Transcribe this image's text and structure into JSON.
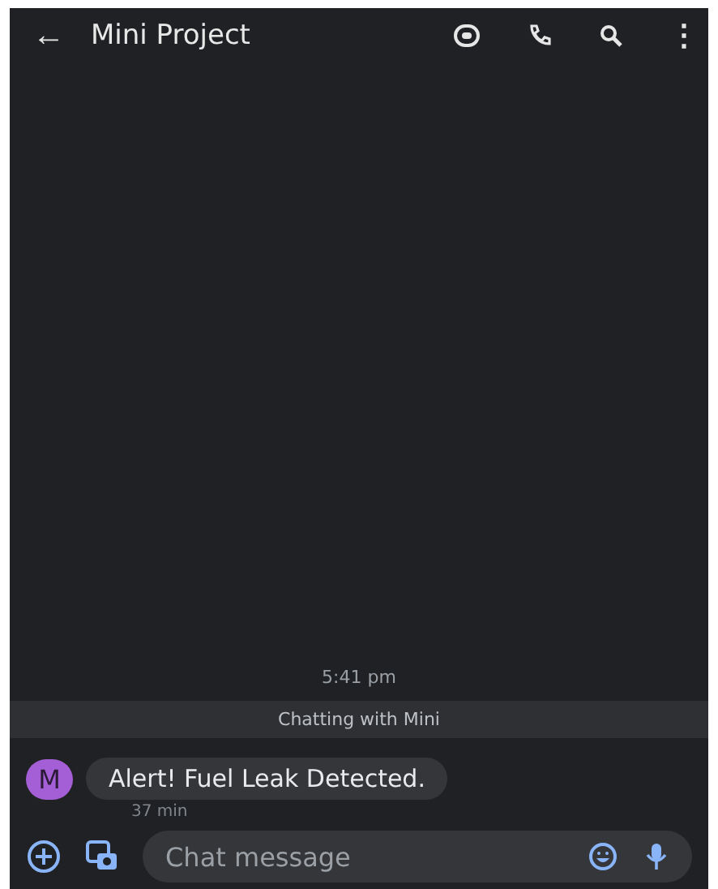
{
  "header": {
    "back": "←",
    "title": "Mini Project",
    "menu": "⋮"
  },
  "timestamp": "5:41 pm",
  "banner": "Chatting with Mini",
  "message": {
    "avatar": "M",
    "color": "#a45fd6",
    "text": "Alert! Fuel Leak Detected.",
    "time": "37 min"
  },
  "composer": {
    "placeholder": "Chat message"
  }
}
